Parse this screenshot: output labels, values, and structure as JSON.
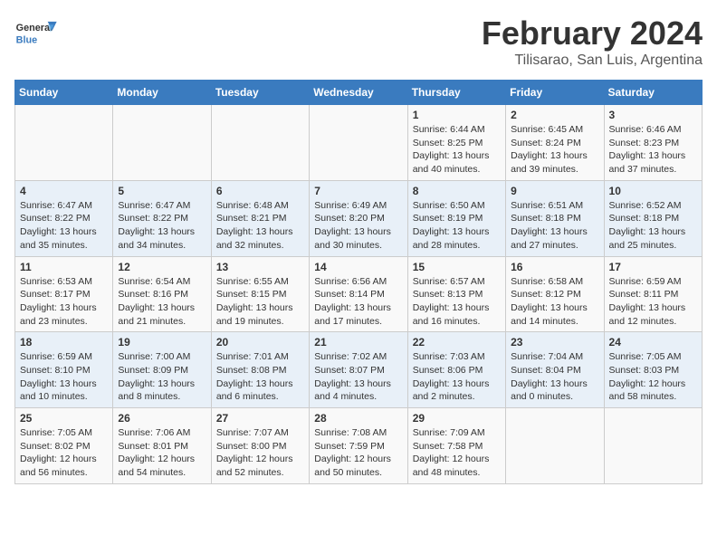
{
  "header": {
    "logo_general": "General",
    "logo_blue": "Blue",
    "month": "February 2024",
    "location": "Tilisarao, San Luis, Argentina"
  },
  "days_of_week": [
    "Sunday",
    "Monday",
    "Tuesday",
    "Wednesday",
    "Thursday",
    "Friday",
    "Saturday"
  ],
  "weeks": [
    [
      {
        "day": "",
        "info": ""
      },
      {
        "day": "",
        "info": ""
      },
      {
        "day": "",
        "info": ""
      },
      {
        "day": "",
        "info": ""
      },
      {
        "day": "1",
        "info": "Sunrise: 6:44 AM\nSunset: 8:25 PM\nDaylight: 13 hours\nand 40 minutes."
      },
      {
        "day": "2",
        "info": "Sunrise: 6:45 AM\nSunset: 8:24 PM\nDaylight: 13 hours\nand 39 minutes."
      },
      {
        "day": "3",
        "info": "Sunrise: 6:46 AM\nSunset: 8:23 PM\nDaylight: 13 hours\nand 37 minutes."
      }
    ],
    [
      {
        "day": "4",
        "info": "Sunrise: 6:47 AM\nSunset: 8:22 PM\nDaylight: 13 hours\nand 35 minutes."
      },
      {
        "day": "5",
        "info": "Sunrise: 6:47 AM\nSunset: 8:22 PM\nDaylight: 13 hours\nand 34 minutes."
      },
      {
        "day": "6",
        "info": "Sunrise: 6:48 AM\nSunset: 8:21 PM\nDaylight: 13 hours\nand 32 minutes."
      },
      {
        "day": "7",
        "info": "Sunrise: 6:49 AM\nSunset: 8:20 PM\nDaylight: 13 hours\nand 30 minutes."
      },
      {
        "day": "8",
        "info": "Sunrise: 6:50 AM\nSunset: 8:19 PM\nDaylight: 13 hours\nand 28 minutes."
      },
      {
        "day": "9",
        "info": "Sunrise: 6:51 AM\nSunset: 8:18 PM\nDaylight: 13 hours\nand 27 minutes."
      },
      {
        "day": "10",
        "info": "Sunrise: 6:52 AM\nSunset: 8:18 PM\nDaylight: 13 hours\nand 25 minutes."
      }
    ],
    [
      {
        "day": "11",
        "info": "Sunrise: 6:53 AM\nSunset: 8:17 PM\nDaylight: 13 hours\nand 23 minutes."
      },
      {
        "day": "12",
        "info": "Sunrise: 6:54 AM\nSunset: 8:16 PM\nDaylight: 13 hours\nand 21 minutes."
      },
      {
        "day": "13",
        "info": "Sunrise: 6:55 AM\nSunset: 8:15 PM\nDaylight: 13 hours\nand 19 minutes."
      },
      {
        "day": "14",
        "info": "Sunrise: 6:56 AM\nSunset: 8:14 PM\nDaylight: 13 hours\nand 17 minutes."
      },
      {
        "day": "15",
        "info": "Sunrise: 6:57 AM\nSunset: 8:13 PM\nDaylight: 13 hours\nand 16 minutes."
      },
      {
        "day": "16",
        "info": "Sunrise: 6:58 AM\nSunset: 8:12 PM\nDaylight: 13 hours\nand 14 minutes."
      },
      {
        "day": "17",
        "info": "Sunrise: 6:59 AM\nSunset: 8:11 PM\nDaylight: 13 hours\nand 12 minutes."
      }
    ],
    [
      {
        "day": "18",
        "info": "Sunrise: 6:59 AM\nSunset: 8:10 PM\nDaylight: 13 hours\nand 10 minutes."
      },
      {
        "day": "19",
        "info": "Sunrise: 7:00 AM\nSunset: 8:09 PM\nDaylight: 13 hours\nand 8 minutes."
      },
      {
        "day": "20",
        "info": "Sunrise: 7:01 AM\nSunset: 8:08 PM\nDaylight: 13 hours\nand 6 minutes."
      },
      {
        "day": "21",
        "info": "Sunrise: 7:02 AM\nSunset: 8:07 PM\nDaylight: 13 hours\nand 4 minutes."
      },
      {
        "day": "22",
        "info": "Sunrise: 7:03 AM\nSunset: 8:06 PM\nDaylight: 13 hours\nand 2 minutes."
      },
      {
        "day": "23",
        "info": "Sunrise: 7:04 AM\nSunset: 8:04 PM\nDaylight: 13 hours\nand 0 minutes."
      },
      {
        "day": "24",
        "info": "Sunrise: 7:05 AM\nSunset: 8:03 PM\nDaylight: 12 hours\nand 58 minutes."
      }
    ],
    [
      {
        "day": "25",
        "info": "Sunrise: 7:05 AM\nSunset: 8:02 PM\nDaylight: 12 hours\nand 56 minutes."
      },
      {
        "day": "26",
        "info": "Sunrise: 7:06 AM\nSunset: 8:01 PM\nDaylight: 12 hours\nand 54 minutes."
      },
      {
        "day": "27",
        "info": "Sunrise: 7:07 AM\nSunset: 8:00 PM\nDaylight: 12 hours\nand 52 minutes."
      },
      {
        "day": "28",
        "info": "Sunrise: 7:08 AM\nSunset: 7:59 PM\nDaylight: 12 hours\nand 50 minutes."
      },
      {
        "day": "29",
        "info": "Sunrise: 7:09 AM\nSunset: 7:58 PM\nDaylight: 12 hours\nand 48 minutes."
      },
      {
        "day": "",
        "info": ""
      },
      {
        "day": "",
        "info": ""
      }
    ]
  ]
}
